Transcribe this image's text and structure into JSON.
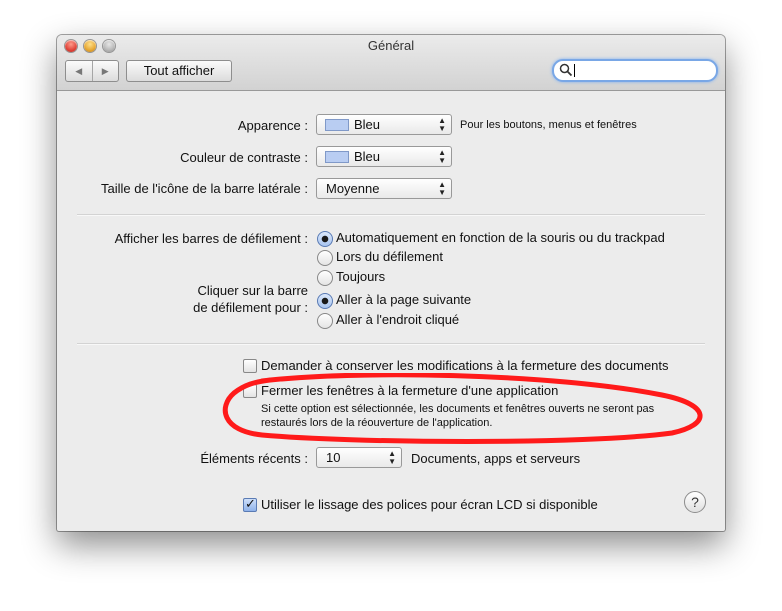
{
  "window": {
    "title": "Général",
    "show_all": "Tout afficher",
    "nav_back": "◀",
    "nav_forward": "▶",
    "search_value": ""
  },
  "appearance": {
    "label": "Apparence :",
    "value": "Bleu",
    "hint": "Pour les boutons, menus et fenêtres"
  },
  "highlight": {
    "label": "Couleur de contraste :",
    "value": "Bleu"
  },
  "sidebar_icon": {
    "label": "Taille de l'icône de la barre latérale :",
    "value": "Moyenne"
  },
  "scrollbars": {
    "label": "Afficher les barres de défilement :",
    "options": [
      {
        "label": "Automatiquement en fonction de la souris ou du trackpad",
        "selected": true
      },
      {
        "label": "Lors du défilement",
        "selected": false
      },
      {
        "label": "Toujours",
        "selected": false
      }
    ]
  },
  "click_scrollbar": {
    "label_line1": "Cliquer sur la barre",
    "label_line2": "de défilement pour :",
    "options": [
      {
        "label": "Aller à la page suivante",
        "selected": true
      },
      {
        "label": "Aller à l'endroit cliqué",
        "selected": false
      }
    ]
  },
  "ask_keep_changes": {
    "label": "Demander à conserver les modifications à la fermeture des documents",
    "checked": false
  },
  "close_windows": {
    "label": "Fermer les fenêtres à la fermeture d'une application",
    "checked": false,
    "note_line1": "Si cette option est sélectionnée, les documents et fenêtres ouverts ne seront pas",
    "note_line2": "restaurés lors de la réouverture de l'application."
  },
  "recent_items": {
    "label": "Éléments récents :",
    "value": "10",
    "suffix": "Documents, apps et serveurs"
  },
  "lcd_smoothing": {
    "label": "Utiliser le lissage des polices pour écran LCD si disponible",
    "checked": true
  },
  "help": {
    "label": "?"
  },
  "colors": {
    "annotation": "#ff1a1a",
    "focus_ring": "#79a7e6",
    "window_bg": "#ececec"
  }
}
